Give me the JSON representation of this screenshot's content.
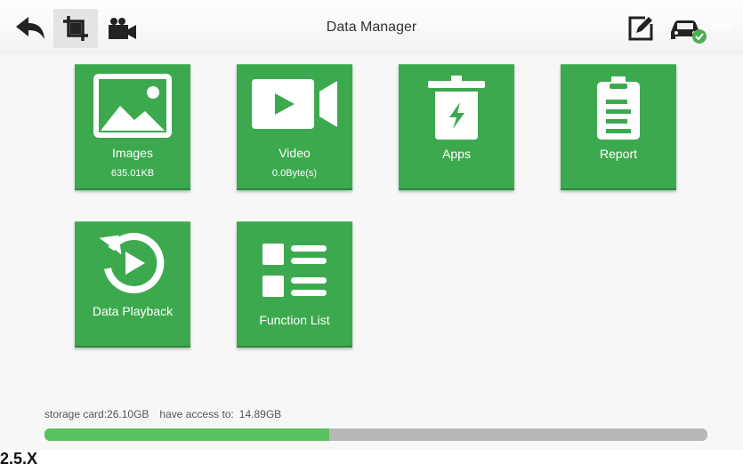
{
  "header": {
    "title": "Data Manager",
    "voltage": "12.3V",
    "icons": [
      "back-icon",
      "crop-icon",
      "video-camera-icon",
      "edit-icon",
      "car-icon",
      "check-icon"
    ]
  },
  "tiles": [
    {
      "label": "Images",
      "sub": "635.01KB",
      "icon": "image-icon"
    },
    {
      "label": "Video",
      "sub": "0.0Byte(s)",
      "icon": "play-video-icon"
    },
    {
      "label": "Apps",
      "sub": "",
      "icon": "trash-bolt-icon"
    },
    {
      "label": "Report",
      "sub": "",
      "icon": "clipboard-icon"
    },
    {
      "label": "Data Playback",
      "sub": "",
      "icon": "replay-icon"
    },
    {
      "label": "Function List",
      "sub": "",
      "icon": "list-icon"
    }
  ],
  "storage": {
    "card_label": "storage card:26.10GB",
    "access_label": "have access to:",
    "access_value": "14.89GB",
    "used_fraction": 0.43
  },
  "caption": "2.5.X",
  "colors": {
    "tile_green": "#3da94f",
    "progress_fill": "#59c15f",
    "progress_track": "#b8b8b8",
    "status_green": "#4caf50"
  }
}
